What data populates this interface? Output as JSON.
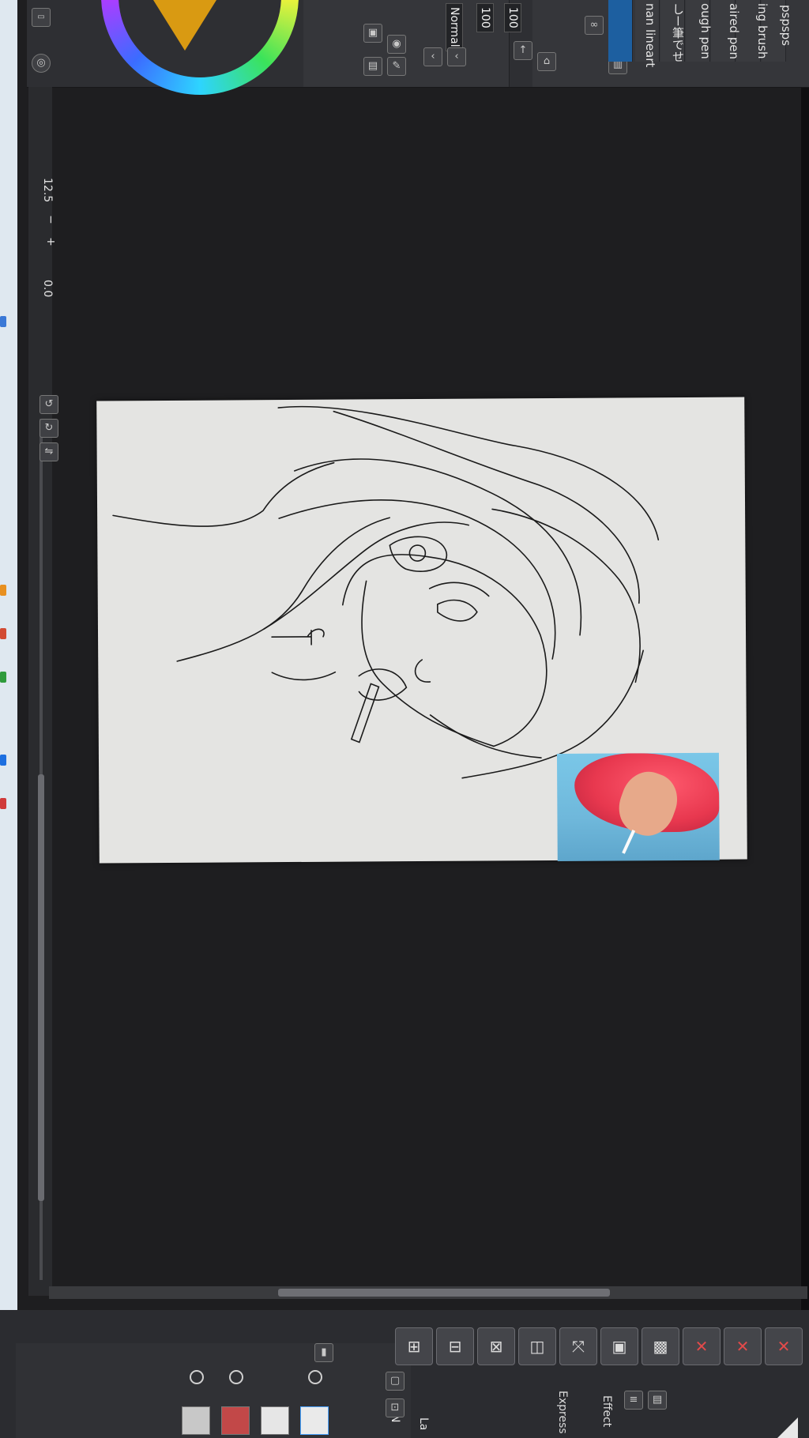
{
  "colors": {
    "taskbar_icons": [
      "#d24b32",
      "#e89020",
      "#2f9b3c",
      "#1d6fe0",
      "#d03a3a",
      "#3a78d6"
    ]
  },
  "brushes": {
    "items": [
      "pspsps",
      "ing brush",
      "aired pen",
      "ough pen",
      "しー筆でせ",
      "nan lineart"
    ],
    "selected_index": 5
  },
  "tool_property": {
    "blend_mode": "Normal",
    "opacity_1": "100",
    "opacity_2": "100",
    "size": "100"
  },
  "navigator": {
    "zoom": "12.5",
    "minus": "−",
    "plus": "+",
    "rotation": "0.0"
  },
  "layers": {
    "blend_label": "N",
    "panel_label": "La",
    "effect_label": "Effect",
    "expression_label": "Express"
  }
}
